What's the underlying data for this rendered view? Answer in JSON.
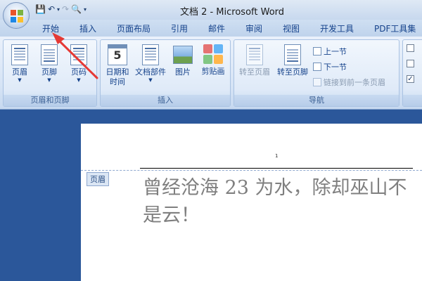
{
  "window": {
    "title": "文档 2 - Microsoft Word"
  },
  "tabs": [
    "开始",
    "插入",
    "页面布局",
    "引用",
    "邮件",
    "审阅",
    "视图",
    "开发工具",
    "PDF工具集"
  ],
  "groups": {
    "header_footer": {
      "label": "页眉和页脚",
      "buttons": [
        "页眉",
        "页脚",
        "页码"
      ]
    },
    "insert": {
      "label": "插入",
      "date_time": "日期和时间",
      "doc_parts": "文档部件",
      "picture": "图片",
      "clipart": "剪贴画",
      "cal_number": "5"
    },
    "navigation": {
      "label": "导航",
      "goto_header": "转至页眉",
      "goto_footer": "转至页脚",
      "prev_section": "上一节",
      "next_section": "下一节",
      "link_previous": "链接到前一条页眉"
    }
  },
  "options_checks": [
    "",
    "",
    "✓"
  ],
  "document": {
    "page_number": "1",
    "header_tag": "页眉",
    "body_text": "曾经沧海 23 为水，除却巫山不是云！"
  }
}
